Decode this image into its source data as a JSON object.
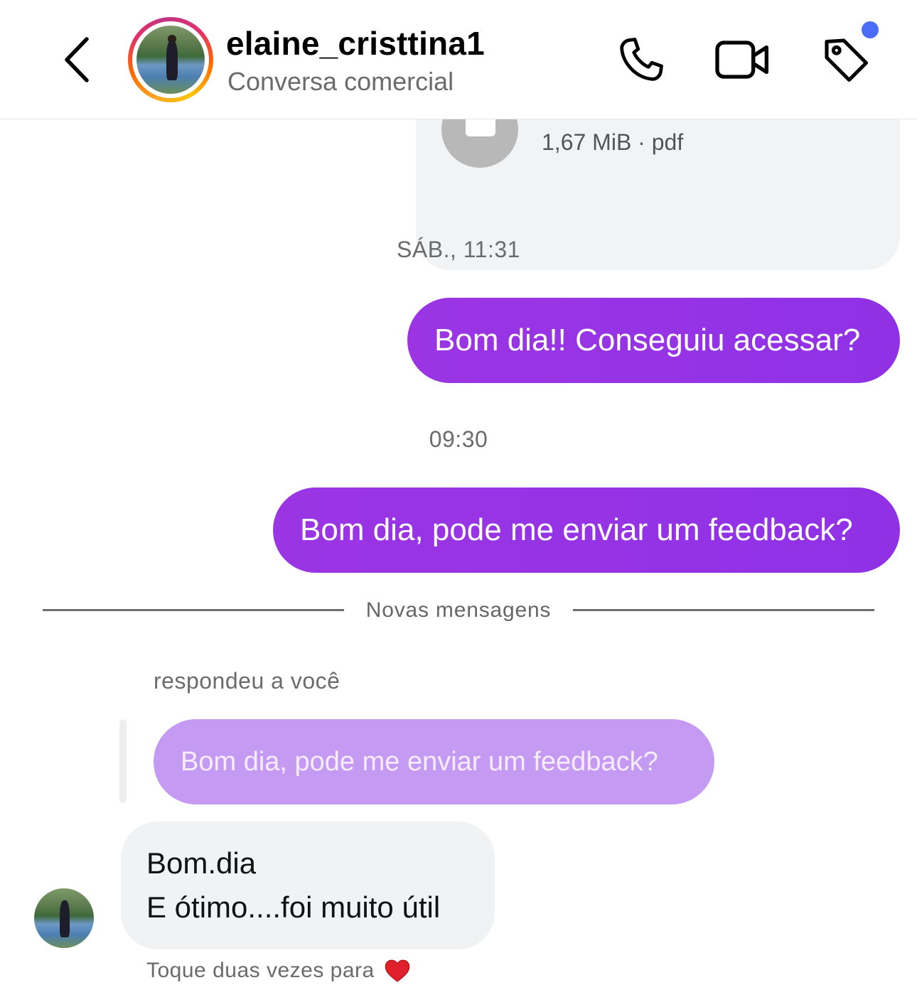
{
  "header": {
    "username": "elaine_cristtina1",
    "subtitle": "Conversa comercial",
    "back_icon": "chevron-left-icon",
    "call_icon": "phone-icon",
    "video_icon": "video-camera-icon",
    "tag_icon": "tag-icon",
    "notification_dot_color": "#4a6cf7"
  },
  "messages": {
    "file": {
      "meta": "1,67 MiB · pdf",
      "icon": "document-icon"
    },
    "timestamp_1": "SÁB., 11:31",
    "outgoing_1": "Bom dia!! Conseguiu acessar?",
    "timestamp_2": "09:30",
    "outgoing_2": "Bom dia, pode me enviar um feedback?",
    "divider_label": "Novas mensagens",
    "replied_label": "respondeu a você",
    "quoted_text": "Bom dia, pode me enviar um feedback?",
    "incoming_line_1": "Bom.dia",
    "incoming_line_2": "E ótimo....foi muito útil",
    "hint": "Toque duas vezes para",
    "hint_icon": "heart-icon"
  },
  "colors": {
    "outgoing_bubble": "#9b35e4",
    "quoted_bubble": "#c59af2",
    "incoming_bubble": "#f1f2f4"
  }
}
